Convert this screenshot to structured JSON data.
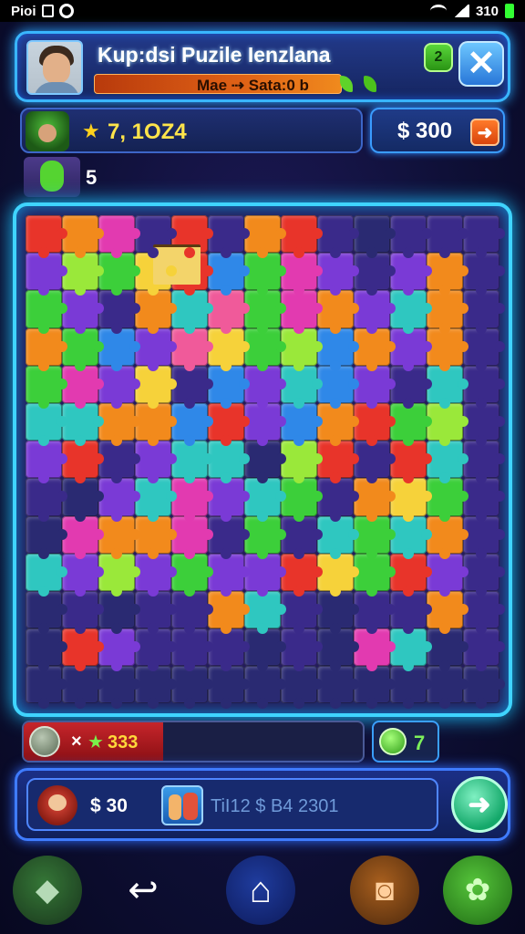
{
  "status_bar": {
    "carrier": "Pioi",
    "battery_text": "310"
  },
  "header": {
    "title": "Kup:dsi Puzile Ienzlana",
    "bar_text": "Mae ⇢ Sata:0 b",
    "badge_label": "2",
    "close_symbol": "✕"
  },
  "stats": {
    "stars_value": "7, 1OZ4",
    "money_value": "$ 300",
    "money_arrow": "➜",
    "level_value": "5"
  },
  "board": {
    "colors": {
      "red": "#e8342a",
      "orange": "#f28a1c",
      "yellow": "#f6d23a",
      "green": "#3ccf3a",
      "lime": "#9ae83a",
      "teal": "#2fc7c0",
      "blue": "#2f88e8",
      "purple": "#7a3ad6",
      "magenta": "#e23ab0",
      "pink": "#f05a9a",
      "dpurple": "#3a2a8a",
      "navy": "#2a2a72"
    },
    "rows": [
      [
        "red",
        "orange",
        "magenta",
        "dpurple",
        "red",
        "dpurple",
        "orange",
        "red",
        "dpurple",
        "navy",
        "dpurple",
        "dpurple",
        "dpurple"
      ],
      [
        "purple",
        "lime",
        "green",
        "yellow",
        "red",
        "blue",
        "green",
        "magenta",
        "purple",
        "dpurple",
        "purple",
        "orange",
        "dpurple"
      ],
      [
        "green",
        "purple",
        "dpurple",
        "orange",
        "teal",
        "pink",
        "green",
        "magenta",
        "orange",
        "purple",
        "teal",
        "orange",
        "dpurple"
      ],
      [
        "orange",
        "green",
        "blue",
        "purple",
        "pink",
        "yellow",
        "green",
        "lime",
        "blue",
        "orange",
        "purple",
        "orange",
        "dpurple"
      ],
      [
        "green",
        "magenta",
        "purple",
        "yellow",
        "dpurple",
        "blue",
        "purple",
        "teal",
        "blue",
        "purple",
        "dpurple",
        "teal",
        "dpurple"
      ],
      [
        "teal",
        "teal",
        "orange",
        "orange",
        "blue",
        "red",
        "purple",
        "blue",
        "orange",
        "red",
        "green",
        "lime",
        "dpurple"
      ],
      [
        "purple",
        "red",
        "dpurple",
        "purple",
        "teal",
        "teal",
        "navy",
        "lime",
        "red",
        "dpurple",
        "red",
        "teal",
        "dpurple"
      ],
      [
        "dpurple",
        "navy",
        "purple",
        "teal",
        "magenta",
        "purple",
        "teal",
        "green",
        "dpurple",
        "orange",
        "yellow",
        "green",
        "dpurple"
      ],
      [
        "navy",
        "magenta",
        "orange",
        "orange",
        "magenta",
        "dpurple",
        "green",
        "dpurple",
        "teal",
        "green",
        "teal",
        "orange",
        "dpurple"
      ],
      [
        "teal",
        "purple",
        "lime",
        "purple",
        "green",
        "purple",
        "purple",
        "red",
        "yellow",
        "green",
        "red",
        "purple",
        "dpurple"
      ],
      [
        "navy",
        "dpurple",
        "navy",
        "dpurple",
        "dpurple",
        "orange",
        "teal",
        "dpurple",
        "navy",
        "dpurple",
        "dpurple",
        "orange",
        "dpurple"
      ],
      [
        "navy",
        "red",
        "purple",
        "dpurple",
        "dpurple",
        "dpurple",
        "navy",
        "dpurple",
        "navy",
        "magenta",
        "teal",
        "navy",
        "dpurple"
      ],
      [
        "navy",
        "navy",
        "navy",
        "navy",
        "navy",
        "navy",
        "navy",
        "navy",
        "navy",
        "navy",
        "navy",
        "navy",
        "navy"
      ]
    ]
  },
  "progress": {
    "multiplier": "×",
    "value": "333",
    "fill_fraction": 0.41,
    "gem_value": "7"
  },
  "bottom": {
    "price": "$ 30",
    "info_text": "TiI12 $ B4 2301",
    "go_symbol": "➜"
  },
  "navbar": {
    "back_game_symbol": "◆",
    "back_symbol": "↩",
    "home_symbol": "⌂",
    "camera_symbol": "◙",
    "settings_symbol": "✿"
  }
}
